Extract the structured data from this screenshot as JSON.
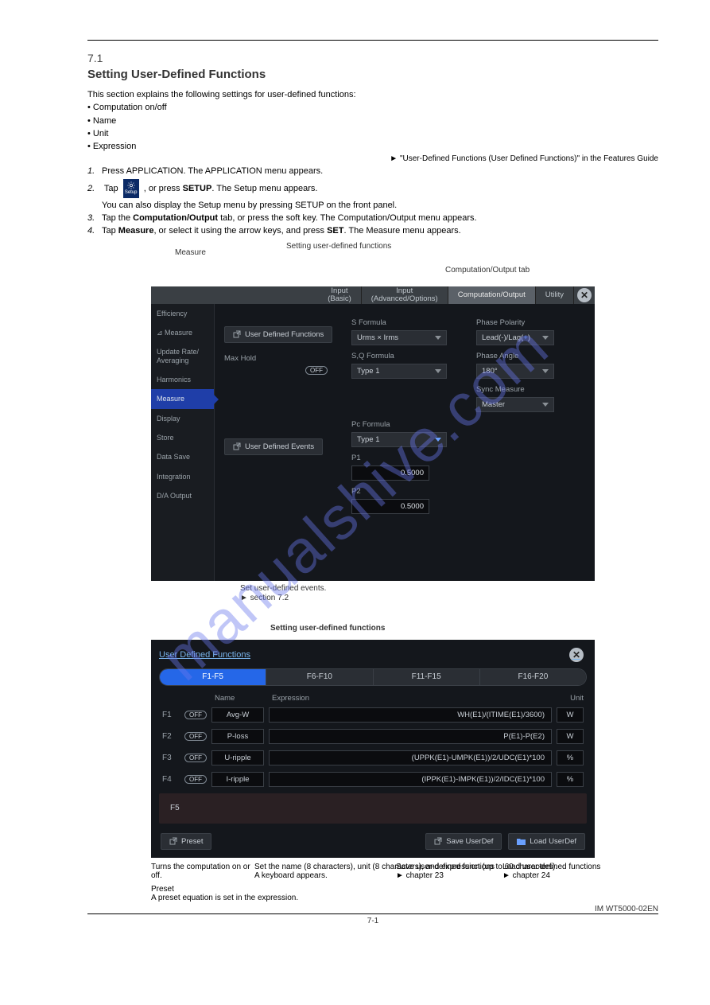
{
  "watermark": "manualshive.com",
  "section_number": "7.1",
  "section_title": "Setting User-Defined Functions",
  "setup_icon_label": "Setup",
  "intro": "This section explains the following settings for user-defined functions:",
  "bullets": [
    "Computation on/off",
    "Name",
    "Unit",
    "Expression"
  ],
  "features_ref": "► \"User-Defined Functions (User Defined Functions)\" in the Features Guide",
  "instructions": {
    "1": "Press APPLICATION. The APPLICATION menu appears.",
    "2a": "Tap       , or press SETUP. The Setup menu appears.",
    "2b": "You can also display the Setup menu by pressing SETUP on the front panel.",
    "3": "Tap the Computation/Output tab, or press the soft key. The Computation/Output menu appears.",
    "4": "Tap Measure, or select it using the arrow keys, and press SET. The Measure menu appears."
  },
  "ann": {
    "measure": "Measure",
    "udf_link": "Setting user-defined functions",
    "comp_tab": "Computation/Output tab",
    "ude": "Set user-defined events.\n► section 7.2",
    "udf_win": "Setting user-defined functions",
    "onoff": "Turns the computation on or off.",
    "name_keys": "Set the name (8 characters), unit (8 characters), and expression (up to 60 characters).\nA keyboard appears.",
    "preset": "Preset\nA preset equation is set in the expression.",
    "save": "Save user-defined functions\n► chapter 23",
    "load": "Load user-defined functions\n► chapter 24"
  },
  "shot1": {
    "tabs": [
      "Input\n(Basic)",
      "Input\n(Advanced/Options)",
      "Computation/Output",
      "Utility"
    ],
    "sidebar": [
      "Efficiency",
      "⊿ Measure",
      "Update Rate/\nAveraging",
      "Harmonics",
      "Measure",
      "Display",
      "Store",
      "Data Save",
      "Integration",
      "D/A Output"
    ],
    "udf_btn": "User Defined Functions",
    "maxhold": "Max Hold",
    "off": "OFF",
    "ude_btn": "User Defined Events",
    "sformula_lbl": "S Formula",
    "sformula_val": "Urms × Irms",
    "sqformula_lbl": "S,Q Formula",
    "sqformula_val": "Type 1",
    "pcformula_lbl": "Pc Formula",
    "pcformula_val": "Type 1",
    "p1_lbl": "P1",
    "p1_val": "0.5000",
    "p2_lbl": "P2",
    "p2_val": "0.5000",
    "polarity_lbl": "Phase Polarity",
    "polarity_val": "Lead(-)/Lag(+)",
    "angle_lbl": "Phase Angle",
    "angle_val": "180°",
    "sync_lbl": "Sync Measure",
    "sync_val": "Master"
  },
  "shot2": {
    "title": "User Defined Functions",
    "tabs": [
      "F1-F5",
      "F6-F10",
      "F11-F15",
      "F16-F20"
    ],
    "hdr": {
      "name": "Name",
      "expr": "Expression",
      "unit": "Unit"
    },
    "rows": [
      {
        "f": "F1",
        "name": "Avg-W",
        "expr": "WH(E1)/(ITIME(E1)/3600)",
        "unit": "W"
      },
      {
        "f": "F2",
        "name": "P-loss",
        "expr": "P(E1)-P(E2)",
        "unit": "W"
      },
      {
        "f": "F3",
        "name": "U-ripple",
        "expr": "(UPPK(E1)-UMPK(E1))/2/UDC(E1)*100",
        "unit": "%"
      },
      {
        "f": "F4",
        "name": "I-ripple",
        "expr": "(IPPK(E1)-IMPK(E1))/2/IDC(E1)*100",
        "unit": "%"
      }
    ],
    "off": "OFF",
    "f5": "F5",
    "preset_btn": "Preset",
    "save_btn": "Save UserDef",
    "load_btn": "Load UserDef"
  },
  "footer": {
    "page": "7-1",
    "im": "IM WT5000-02EN"
  }
}
